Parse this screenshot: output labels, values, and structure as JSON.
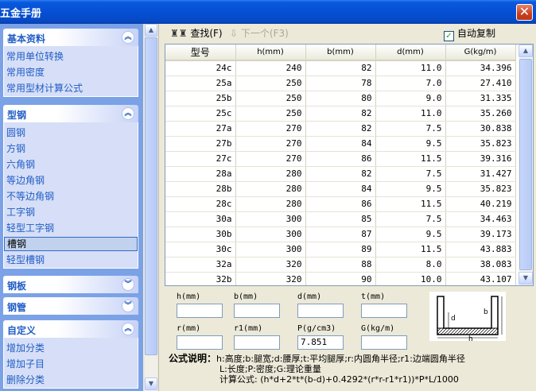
{
  "window": {
    "title": "五金手册",
    "close": "✕"
  },
  "groups": [
    {
      "title": "基本资料",
      "toggle": "up",
      "items": [
        "常用单位转换",
        "常用密度",
        "常用型材计算公式"
      ]
    },
    {
      "title": "型钢",
      "toggle": "up",
      "items": [
        "圆钢",
        "方钢",
        "六角钢",
        "等边角钢",
        "不等边角钢",
        "工字钢",
        "轻型工字钢",
        "槽钢",
        "轻型槽钢"
      ],
      "selected": "槽钢"
    },
    {
      "title": "钢板",
      "toggle": "down",
      "items": []
    },
    {
      "title": "钢管",
      "toggle": "down",
      "items": []
    },
    {
      "title": "自定义",
      "toggle": "up",
      "items": [
        "增加分类",
        "增加子目",
        "删除分类"
      ]
    }
  ],
  "toolbar": {
    "find": "查找(F)",
    "next": "下一个(F3)",
    "autocopy": "自动复制",
    "autocopy_checked": true
  },
  "table": {
    "headers": [
      "型号",
      "h(mm)",
      "b(mm)",
      "d(mm)",
      "G(kg/m)"
    ],
    "rows": [
      [
        "24c",
        "240",
        "82",
        "11.0",
        "34.396"
      ],
      [
        "25a",
        "250",
        "78",
        "7.0",
        "27.410"
      ],
      [
        "25b",
        "250",
        "80",
        "9.0",
        "31.335"
      ],
      [
        "25c",
        "250",
        "82",
        "11.0",
        "35.260"
      ],
      [
        "27a",
        "270",
        "82",
        "7.5",
        "30.838"
      ],
      [
        "27b",
        "270",
        "84",
        "9.5",
        "35.823"
      ],
      [
        "27c",
        "270",
        "86",
        "11.5",
        "39.316"
      ],
      [
        "28a",
        "280",
        "82",
        "7.5",
        "31.427"
      ],
      [
        "28b",
        "280",
        "84",
        "9.5",
        "35.823"
      ],
      [
        "28c",
        "280",
        "86",
        "11.5",
        "40.219"
      ],
      [
        "30a",
        "300",
        "85",
        "7.5",
        "34.463"
      ],
      [
        "30b",
        "300",
        "87",
        "9.5",
        "39.173"
      ],
      [
        "30c",
        "300",
        "89",
        "11.5",
        "43.883"
      ],
      [
        "32a",
        "320",
        "88",
        "8.0",
        "38.083"
      ],
      [
        "32b",
        "320",
        "90",
        "10.0",
        "43.107"
      ]
    ]
  },
  "form": {
    "labels": [
      "h(mm)",
      "b(mm)",
      "d(mm)",
      "t(mm)",
      "r(mm)",
      "r1(mm)",
      "P(g/cm3)",
      "G(kg/m)"
    ],
    "values": [
      "",
      "",
      "",
      "",
      "",
      "",
      "7.851",
      ""
    ],
    "diagram_labels": {
      "b": "b",
      "d": "d",
      "h": "h"
    }
  },
  "formula": {
    "title": "公式说明：",
    "line1": "h:高度;b:腿宽;d:腰厚;t:平均腿厚;r:内圆角半径;r1:边端圆角半径",
    "line2": "L:长度;P:密度;G:理论重量",
    "line3": "计算公式: (h*d+2*t*(b-d)+0.4292*(r*r-r1*r1))*P*L/1000"
  }
}
